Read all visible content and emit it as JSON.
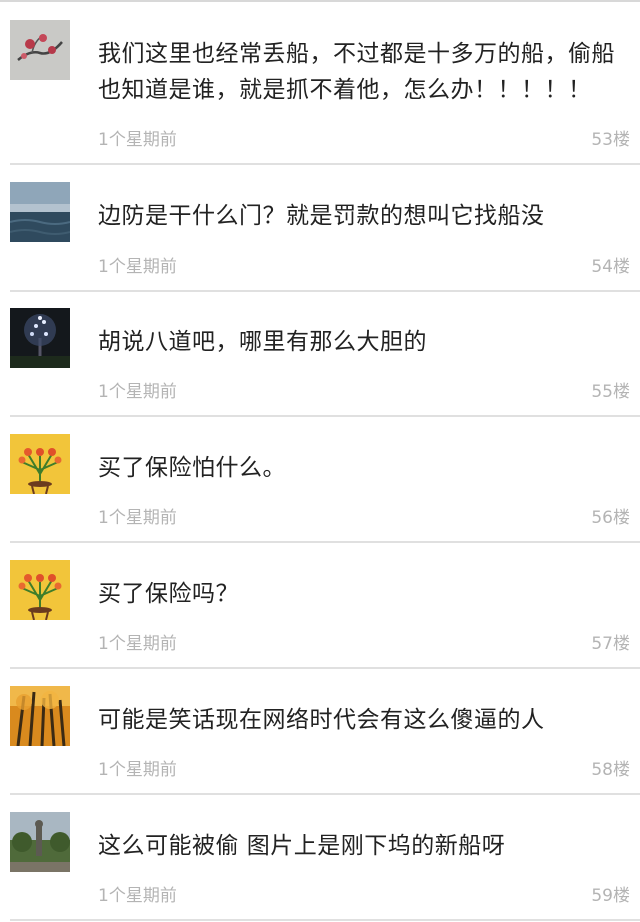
{
  "comments": [
    {
      "avatar": "plum-blossom-painting",
      "text": "我们这里也经常丢船，不过都是十多万的船，偷船也知道是谁，就是抓不着他，怎么办！！！！！",
      "time": "1个星期前",
      "floor": "53楼"
    },
    {
      "avatar": "sea-horizon",
      "text": "边防是干什么门？就是罚款的想叫它找船没",
      "time": "1个星期前",
      "floor": "54楼"
    },
    {
      "avatar": "lit-tree-night",
      "text": "胡说八道吧，哪里有那么大胆的",
      "time": "1个星期前",
      "floor": "55楼"
    },
    {
      "avatar": "tulip-vase",
      "text": "买了保险怕什么。",
      "time": "1个星期前",
      "floor": "56楼"
    },
    {
      "avatar": "tulip-vase",
      "text": "买了保险吗？",
      "time": "1个星期前",
      "floor": "57楼"
    },
    {
      "avatar": "autumn-trees",
      "text": "可能是笑话现在网络时代会有这么傻逼的人",
      "time": "1个星期前",
      "floor": "58楼"
    },
    {
      "avatar": "park-statue",
      "text": "这么可能被偷 图片上是刚下坞的新船呀",
      "time": "1个星期前",
      "floor": "59楼"
    }
  ]
}
